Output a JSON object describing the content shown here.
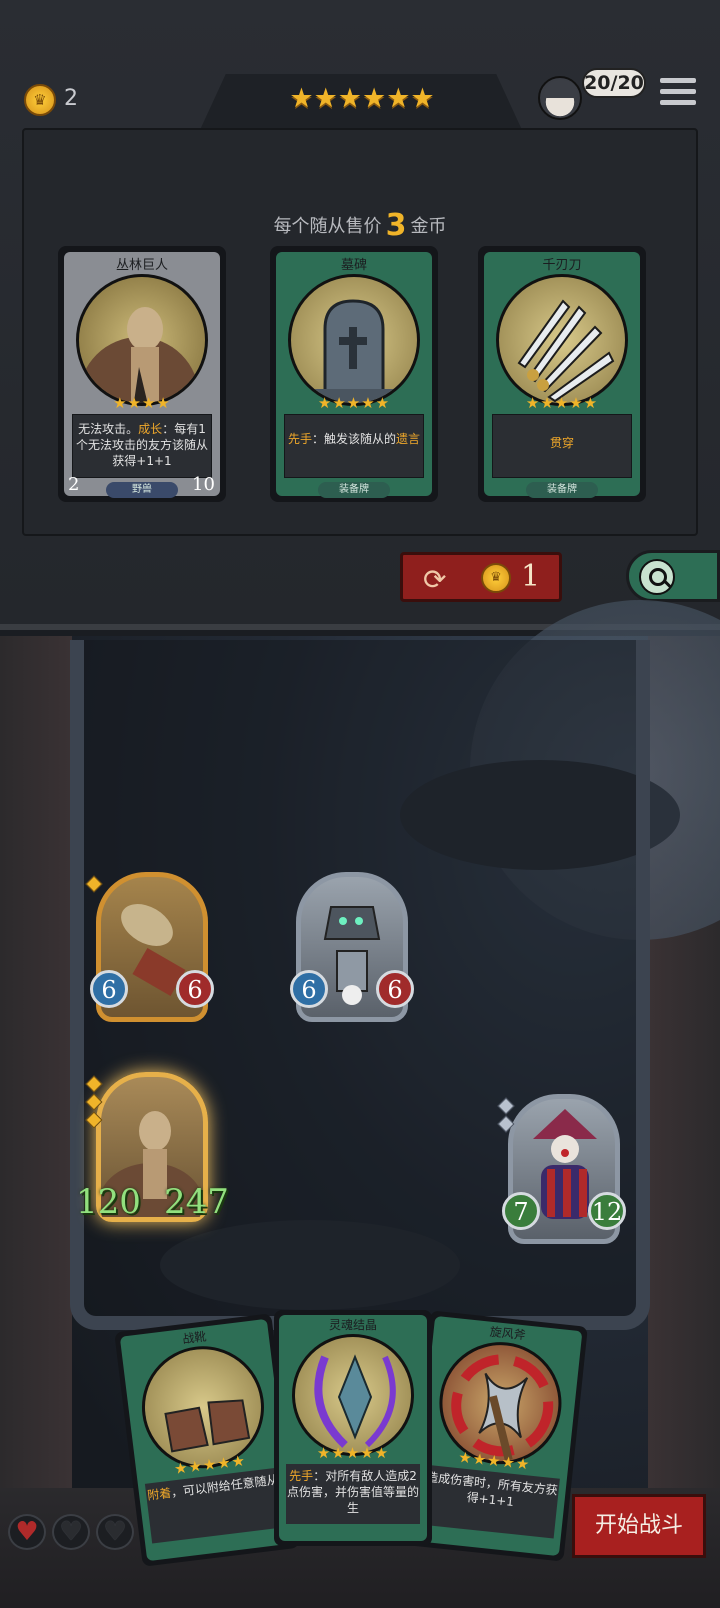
{
  "top_bar": {
    "gold": "2",
    "tier_stars": "★★★★★★",
    "health": "20/20"
  },
  "shop": {
    "sell_prefix": "每个随从售价",
    "sell_amount": "3",
    "sell_suffix": "金币",
    "cards": [
      {
        "name": "丛林巨人",
        "stars": "★★★★",
        "desc_line1": "无法攻击。",
        "desc_hl": "成长",
        "desc_rest": "：每有1个无法攻击的友方该随从获得+1+1",
        "attack": "2",
        "health": "10",
        "tag": "野兽"
      },
      {
        "name": "墓碑",
        "stars": "★★★★★",
        "desc_hl": "先手",
        "desc_rest": "：触发该随从的",
        "desc_hl2": "遗言",
        "tag": "装备牌"
      },
      {
        "name": "千刃刀",
        "stars": "★★★★★",
        "desc_hl": "贯穿",
        "tag": "装备牌"
      }
    ],
    "reroll_cost": "1"
  },
  "board": {
    "minions": [
      {
        "attack": "6",
        "health": "6"
      },
      {
        "attack": "6",
        "health": "6"
      },
      {
        "attack": "120",
        "health": "247"
      },
      {
        "attack": "7",
        "health": "12"
      }
    ]
  },
  "hand": {
    "cards": [
      {
        "name": "战靴",
        "stars": "★★★★★",
        "desc_hl": "附着",
        "desc_rest": "，可以附给任意随从"
      },
      {
        "name": "灵魂结晶",
        "stars": "★★★★★",
        "desc_hl": "先手",
        "desc_rest": "：对所有敌人造成2点伤害，并伤害值等量的生"
      },
      {
        "name": "旋风斧",
        "stars": "★★★★★",
        "desc_rest": "造成伤害时，所有友方获得+1+1"
      }
    ]
  },
  "lives": {
    "full": 1,
    "total": 3
  },
  "start_button": "开始战斗",
  "colors": {
    "gold": "#f0b429",
    "button_red": "#a8201f",
    "equip_green": "#2d6e55"
  }
}
